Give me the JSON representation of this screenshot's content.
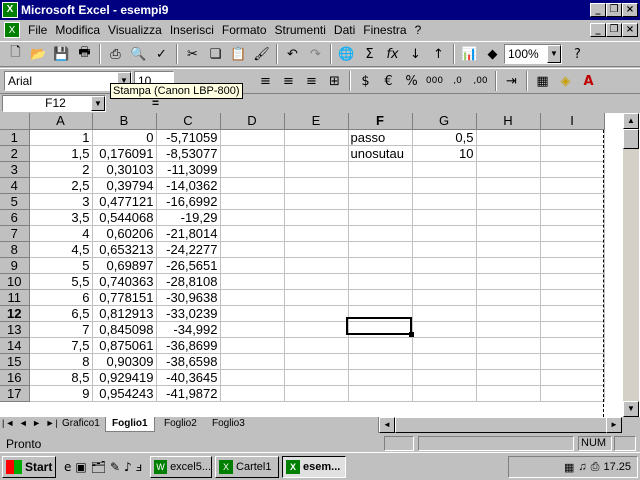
{
  "title": "Microsoft Excel - esempi9",
  "menu": [
    "File",
    "Modifica",
    "Visualizza",
    "Inserisci",
    "Formato",
    "Strumenti",
    "Dati",
    "Finestra",
    "?"
  ],
  "toolbar": {
    "zoom": "100%"
  },
  "format": {
    "font": "Arial",
    "size": "10"
  },
  "tooltip": "Stampa (Canon LBP-800)",
  "namebox": "F12",
  "formula_eq": "=",
  "columns": [
    "A",
    "B",
    "C",
    "D",
    "E",
    "F",
    "G",
    "H",
    "I"
  ],
  "rows": [
    {
      "n": "1",
      "a": "1",
      "b": "0",
      "c": "-5,71059",
      "f": "passo",
      "g": "0,5"
    },
    {
      "n": "2",
      "a": "1,5",
      "b": "0,176091",
      "c": "-8,53077",
      "f": "unosutau",
      "g": "10"
    },
    {
      "n": "3",
      "a": "2",
      "b": "0,30103",
      "c": "-11,3099",
      "f": "",
      "g": ""
    },
    {
      "n": "4",
      "a": "2,5",
      "b": "0,39794",
      "c": "-14,0362",
      "f": "",
      "g": ""
    },
    {
      "n": "5",
      "a": "3",
      "b": "0,477121",
      "c": "-16,6992",
      "f": "",
      "g": ""
    },
    {
      "n": "6",
      "a": "3,5",
      "b": "0,544068",
      "c": "-19,29",
      "f": "",
      "g": ""
    },
    {
      "n": "7",
      "a": "4",
      "b": "0,60206",
      "c": "-21,8014",
      "f": "",
      "g": ""
    },
    {
      "n": "8",
      "a": "4,5",
      "b": "0,653213",
      "c": "-24,2277",
      "f": "",
      "g": ""
    },
    {
      "n": "9",
      "a": "5",
      "b": "0,69897",
      "c": "-26,5651",
      "f": "",
      "g": ""
    },
    {
      "n": "10",
      "a": "5,5",
      "b": "0,740363",
      "c": "-28,8108",
      "f": "",
      "g": ""
    },
    {
      "n": "11",
      "a": "6",
      "b": "0,778151",
      "c": "-30,9638",
      "f": "",
      "g": ""
    },
    {
      "n": "12",
      "a": "6,5",
      "b": "0,812913",
      "c": "-33,0239",
      "f": "",
      "g": ""
    },
    {
      "n": "13",
      "a": "7",
      "b": "0,845098",
      "c": "-34,992",
      "f": "",
      "g": ""
    },
    {
      "n": "14",
      "a": "7,5",
      "b": "0,875061",
      "c": "-36,8699",
      "f": "",
      "g": ""
    },
    {
      "n": "15",
      "a": "8",
      "b": "0,90309",
      "c": "-38,6598",
      "f": "",
      "g": ""
    },
    {
      "n": "16",
      "a": "8,5",
      "b": "0,929419",
      "c": "-40,3645",
      "f": "",
      "g": ""
    },
    {
      "n": "17",
      "a": "9",
      "b": "0,954243",
      "c": "-41,9872",
      "f": "",
      "g": ""
    }
  ],
  "sheets": [
    "Grafico1",
    "Foglio1",
    "Foglio2",
    "Foglio3"
  ],
  "active_sheet": "Foglio1",
  "status": {
    "text": "Pronto",
    "num": "NUM"
  },
  "taskbar": {
    "start": "Start",
    "tasks": [
      "excel5...",
      "Cartel1",
      "esem..."
    ],
    "clock": "17.25"
  }
}
